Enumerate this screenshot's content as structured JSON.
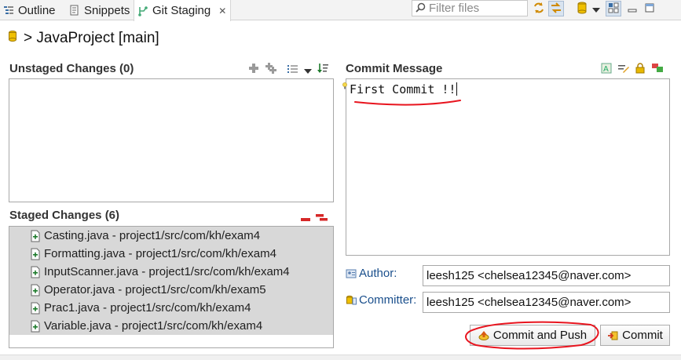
{
  "tabs": [
    {
      "label": "Outline",
      "icon": "outline-icon"
    },
    {
      "label": "Snippets",
      "icon": "snippets-icon"
    },
    {
      "label": "Git Staging",
      "icon": "git-staging-icon",
      "active": true,
      "close": "✕"
    }
  ],
  "toolbar": {
    "filter_placeholder": "Filter files",
    "icons": [
      "sync-icon",
      "link-selection-icon",
      "repository-icon",
      "dropdown-arrow-icon",
      "layout-icon",
      "minimize-icon",
      "maximize-icon"
    ]
  },
  "header": {
    "title": "> JavaProject [main]"
  },
  "unstaged": {
    "title": "Unstaged Changes (0)",
    "items": []
  },
  "staged": {
    "title": "Staged Changes (6)",
    "items": [
      {
        "label": "Casting.java - project1/src/com/kh/exam4"
      },
      {
        "label": "Formatting.java - project1/src/com/kh/exam4"
      },
      {
        "label": "InputScanner.java - project1/src/com/kh/exam4"
      },
      {
        "label": "Operator.java - project1/src/com/kh/exam5"
      },
      {
        "label": "Prac1.java - project1/src/com/kh/exam4"
      },
      {
        "label": "Variable.java - project1/src/com/kh/exam4"
      }
    ]
  },
  "commit": {
    "title": "Commit Message",
    "message": "First Commit !!",
    "author_label": "Author:",
    "author_value": "leesh125 <chelsea12345@naver.com>",
    "committer_label": "Committer:",
    "committer_value": "leesh125 <chelsea12345@naver.com>",
    "commit_push_label": "Commit and Push",
    "commit_label": "Commit"
  },
  "colors": {
    "annotation": "#e8141e",
    "link": "#1a4f8c",
    "staged_bg": "#d8d8d8"
  }
}
